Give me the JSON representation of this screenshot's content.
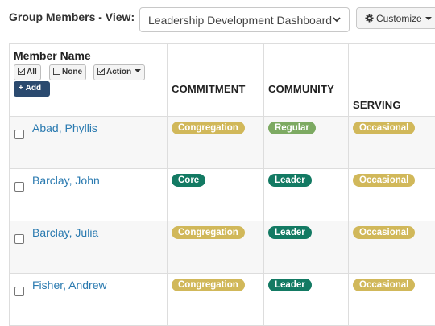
{
  "header": {
    "view_label": "Group Members - View:",
    "view_select_value": "Leadership Development Dashboard",
    "customize_label": "Customize"
  },
  "columns": {
    "member_name": "Member Name",
    "all_label": "All",
    "none_label": "None",
    "action_label": "Action",
    "add_label": "Add",
    "commitment": "COMMITMENT",
    "community": "COMMUNITY",
    "serving": "SERVING"
  },
  "colors": {
    "congregation": "#d1b85a",
    "core": "#137a63",
    "regular": "#7daa62",
    "leader": "#137a63",
    "occasional": "#d1b85a"
  },
  "members": [
    {
      "name": "Abad, Phyllis",
      "commitment": "Congregation",
      "community": "Regular",
      "serving": "Occasional"
    },
    {
      "name": "Barclay, John",
      "commitment": "Core",
      "community": "Leader",
      "serving": "Occasional"
    },
    {
      "name": "Barclay, Julia",
      "commitment": "Congregation",
      "community": "Leader",
      "serving": "Occasional"
    },
    {
      "name": "Fisher, Andrew",
      "commitment": "Congregation",
      "community": "Leader",
      "serving": "Occasional"
    }
  ]
}
